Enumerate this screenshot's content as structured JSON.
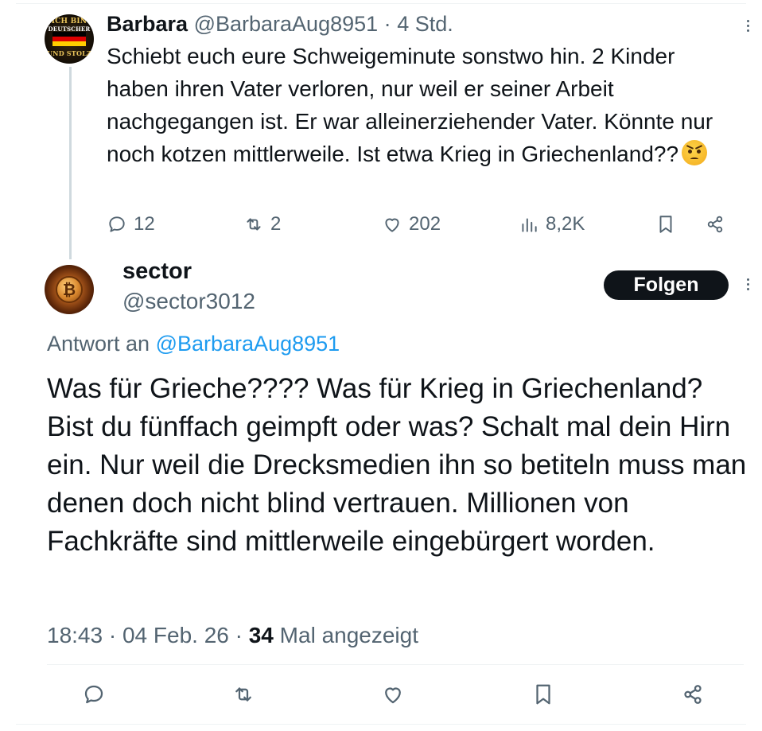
{
  "parent_tweet": {
    "name": "Barbara",
    "handle": "@BarbaraAug8951",
    "separator": "·",
    "time": "4 Std.",
    "text": "Schiebt euch eure Schweigeminute sonstwo hin. 2 Kinder haben ihren Vater verloren, nur weil er seiner Arbeit nachgegangen ist. Er war alleinerziehender Vater. Könnte nur noch kotzen mittlerweile. Ist etwa Krieg in Griechenland??",
    "emoji": "angry-face",
    "avatar_text": [
      "ICH BIN",
      "DEUTSCHER",
      "UND STOLZ"
    ],
    "stats": {
      "replies": "12",
      "reposts": "2",
      "likes": "202",
      "views": "8,2K"
    }
  },
  "main_tweet": {
    "name": "sector",
    "handle": "@sector3012",
    "follow_label": "Folgen",
    "reply_prefix": "Antwort an",
    "reply_handle": "@BarbaraAug8951",
    "text": "Was für Grieche???? Was für Krieg in Griechenland? Bist du fünffach geimpft oder was? Schalt mal dein Hirn ein. Nur weil die Drecksmedien ihn so betiteln muss man denen doch nicht blind vertrauen. Millionen von Fachkräfte sind mittlerweile eingebürgert worden.",
    "time": "18:43",
    "date": "04 Feb. 26",
    "separator": "·",
    "view_count": "34",
    "view_label": "Mal angezeigt"
  },
  "icons": {
    "reply": "reply-icon",
    "repost": "repost-icon",
    "like": "heart-icon",
    "views": "views-icon",
    "bookmark": "bookmark-icon",
    "share": "share-icon",
    "more": "more-options-icon"
  },
  "colors": {
    "text": "#0f1419",
    "secondary": "#536471",
    "link": "#1d9bf0",
    "follow_bg": "#0f1419",
    "thread_line": "#cfd9de",
    "divider": "#eff3f4"
  }
}
